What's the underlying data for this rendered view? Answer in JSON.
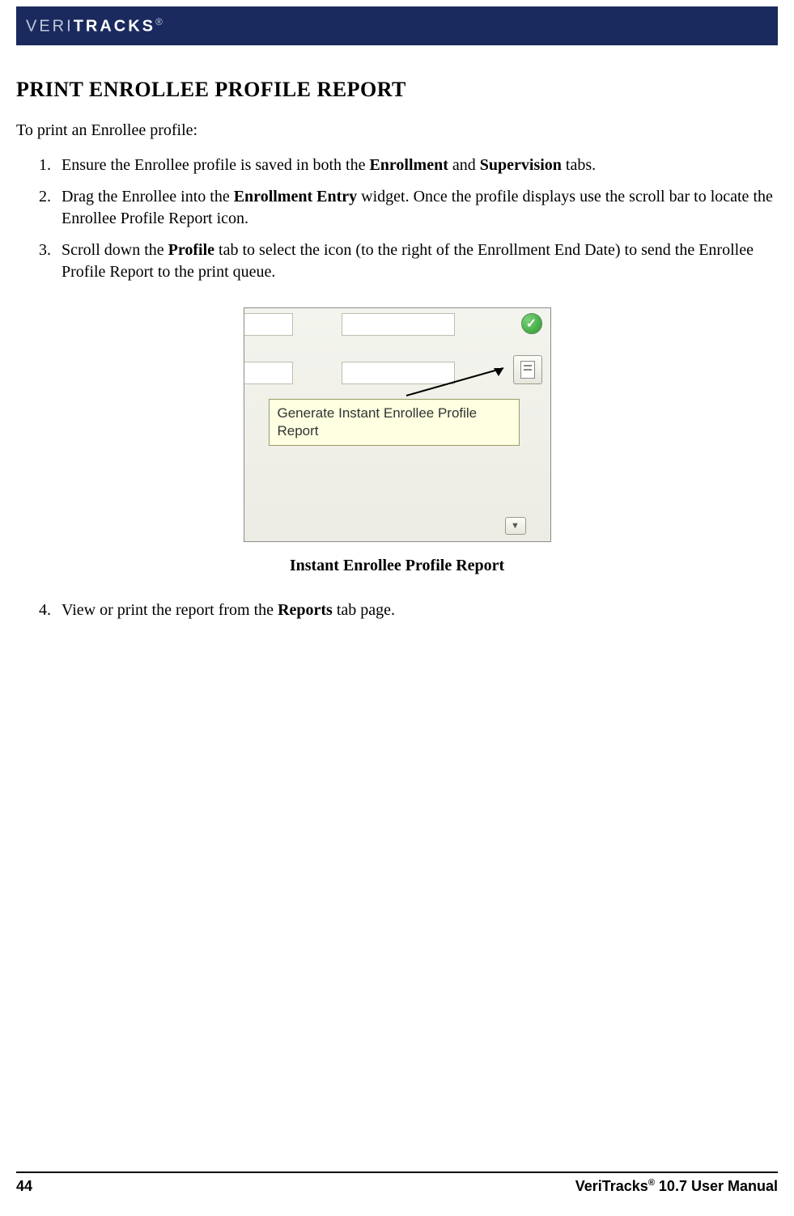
{
  "header": {
    "brand_prefix": "VERI",
    "brand_suffix": "TRACKS",
    "reg": "®"
  },
  "heading": "PRINT ENROLLEE PROFILE REPORT",
  "intro": "To print an Enrollee profile:",
  "steps": {
    "s1_a": "Ensure the Enrollee profile is saved in both the ",
    "s1_b": "Enrollment",
    "s1_c": " and ",
    "s1_d": "Supervision",
    "s1_e": " tabs.",
    "s2_a": "Drag the Enrollee into the ",
    "s2_b": "Enrollment Entry",
    "s2_c": " widget.  Once the profile displays use the scroll bar to locate the Enrollee Profile Report icon.",
    "s3_a": "Scroll down the ",
    "s3_b": "Profile",
    "s3_c": " tab to select the icon (to the right of the Enrollment End Date) to send the Enrollee Profile Report to the print queue.",
    "s4_a": "View or print the report from the ",
    "s4_b": "Reports",
    "s4_c": " tab page."
  },
  "figure": {
    "tooltip": "Generate Instant Enrollee Profile Report",
    "caption": "Instant Enrollee Profile Report",
    "check_glyph": "✓",
    "chevron_glyph": "▼"
  },
  "footer": {
    "page": "44",
    "product": "VeriTracks",
    "reg": "®",
    "suffix": " 10.7 User Manual"
  }
}
